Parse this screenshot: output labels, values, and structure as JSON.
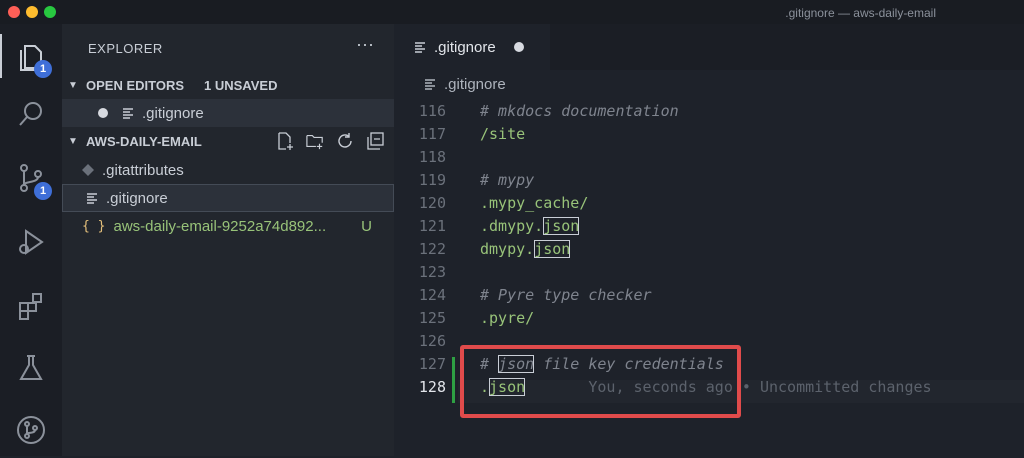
{
  "window": {
    "title": ".gitignore — aws-daily-email"
  },
  "activity_bar": {
    "explorer_badge": "1",
    "scm_badge": "1"
  },
  "sidebar": {
    "title": "EXPLORER",
    "more": "···",
    "open_editors": {
      "label": "OPEN EDITORS",
      "unsaved": "1 UNSAVED",
      "file": ".gitignore"
    },
    "workspace": {
      "label": "AWS-DAILY-EMAIL"
    },
    "files": [
      {
        "name": ".gitattributes",
        "status": ""
      },
      {
        "name": ".gitignore",
        "status": ""
      },
      {
        "name": "aws-daily-email-9252a74d892...",
        "status": "U"
      }
    ]
  },
  "editor": {
    "tab": {
      "label": ".gitignore"
    },
    "breadcrumb": ".gitignore",
    "lines": [
      {
        "num": "116",
        "text": "# mkdocs documentation"
      },
      {
        "num": "117",
        "text": "/site"
      },
      {
        "num": "118",
        "text": ""
      },
      {
        "num": "119",
        "text": "# mypy"
      },
      {
        "num": "120",
        "text": ".mypy_cache/"
      },
      {
        "num": "121",
        "pre": ".dmypy.",
        "hl": "json"
      },
      {
        "num": "122",
        "pre": "dmypy.",
        "hl": "json"
      },
      {
        "num": "123",
        "text": ""
      },
      {
        "num": "124",
        "text": "# Pyre type checker"
      },
      {
        "num": "125",
        "text": ".pyre/"
      },
      {
        "num": "126",
        "text": ""
      },
      {
        "num": "127",
        "pre": "# ",
        "hl": "json",
        "post": " file key credentials"
      },
      {
        "num": "128",
        "pre": ".",
        "hl": "json",
        "blame": "You, seconds ago • Uncommitted changes"
      }
    ]
  },
  "colors": {
    "accent": "#3f6fd8",
    "highlight_box": "#e04b4b",
    "string_green": "#98c379"
  }
}
